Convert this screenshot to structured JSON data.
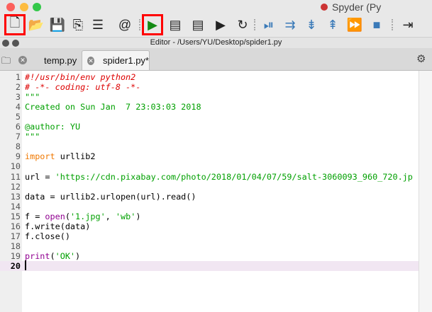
{
  "window": {
    "title": "Spyder (Py"
  },
  "toolbar": {
    "buttons": [
      {
        "name": "new-file",
        "glyph": "🗋"
      },
      {
        "name": "open-file",
        "glyph": "📂"
      },
      {
        "name": "save-file",
        "glyph": "💾"
      },
      {
        "name": "save-all",
        "glyph": "⎘"
      },
      {
        "name": "file-list",
        "glyph": "☰"
      },
      {
        "name": "symbol-finder",
        "glyph": "@"
      },
      {
        "name": "run",
        "glyph": "▶"
      },
      {
        "name": "run-cell",
        "glyph": "▤"
      },
      {
        "name": "run-cell-advance",
        "glyph": "▤"
      },
      {
        "name": "run-selection",
        "glyph": "▶"
      },
      {
        "name": "rerun",
        "glyph": "↻"
      },
      {
        "name": "debug",
        "glyph": "⏯"
      },
      {
        "name": "step",
        "glyph": "⇉"
      },
      {
        "name": "step-into",
        "glyph": "⇟"
      },
      {
        "name": "step-return",
        "glyph": "⇞"
      },
      {
        "name": "continue",
        "glyph": "⏩"
      },
      {
        "name": "stop",
        "glyph": "■"
      },
      {
        "name": "maximize-pane",
        "glyph": "⇥"
      }
    ]
  },
  "editor": {
    "title": "Editor - /Users/YU/Desktop/spider1.py",
    "tabs": [
      {
        "label": "temp.py",
        "active": false
      },
      {
        "label": "spider1.py*",
        "active": true
      }
    ],
    "current_line": 20,
    "lines": [
      [
        [
          "comment",
          "#!/usr/bin/env python2"
        ]
      ],
      [
        [
          "comment",
          "# -*- coding: utf-8 -*-"
        ]
      ],
      [
        [
          "string",
          "\"\"\""
        ]
      ],
      [
        [
          "string",
          "Created on Sun Jan  7 23:03:03 2018"
        ]
      ],
      [],
      [
        [
          "string",
          "@author: YU"
        ]
      ],
      [
        [
          "string",
          "\"\"\""
        ]
      ],
      [],
      [
        [
          "keyword",
          "import"
        ],
        [
          "plain",
          " urllib2"
        ]
      ],
      [],
      [
        [
          "plain",
          "url = "
        ],
        [
          "string",
          "'https://cdn.pixabay.com/photo/2018/01/04/07/59/salt-3060093_960_720.jp"
        ]
      ],
      [],
      [
        [
          "plain",
          "data = urllib2.urlopen(url).read()"
        ]
      ],
      [],
      [
        [
          "plain",
          "f = "
        ],
        [
          "builtin",
          "open"
        ],
        [
          "plain",
          "("
        ],
        [
          "string",
          "'1.jpg'"
        ],
        [
          "plain",
          ", "
        ],
        [
          "string",
          "'wb'"
        ],
        [
          "plain",
          ")"
        ]
      ],
      [
        [
          "plain",
          "f.write(data)"
        ]
      ],
      [
        [
          "plain",
          "f.close()"
        ]
      ],
      [],
      [
        [
          "builtin",
          "print"
        ],
        [
          "plain",
          "("
        ],
        [
          "string",
          "'OK'"
        ],
        [
          "plain",
          ")"
        ]
      ],
      []
    ]
  },
  "colors": {
    "close": "#fc605c",
    "minimize": "#fdbc40",
    "zoom": "#34c84a",
    "highlight": "#ff0000",
    "run": "#138a13",
    "debug": "#3a7ab8"
  }
}
